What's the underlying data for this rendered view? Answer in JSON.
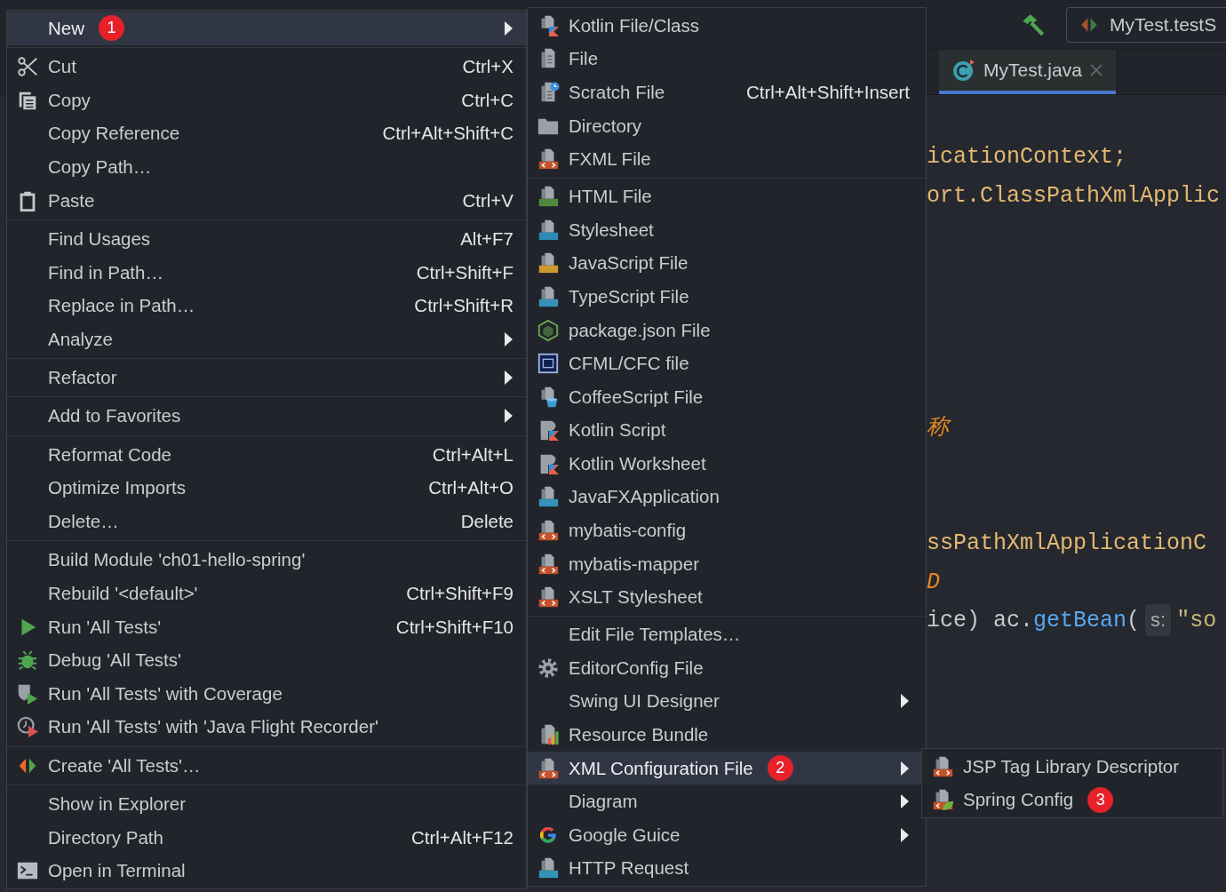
{
  "toolbar": {
    "run_configuration": {
      "label": "MyTest.testS"
    }
  },
  "editor_tabs": [
    {
      "label": "MyTest.java",
      "selected": true
    }
  ],
  "code_lines": [
    {
      "segments": [
        {
          "text": "icationContext;",
          "kind": "type"
        }
      ]
    },
    {
      "segments": [
        {
          "text": "ort.ClassPathXmlApplic",
          "kind": "type"
        }
      ]
    },
    {
      "segments": [
        {
          "text": "称",
          "kind": "accent"
        }
      ]
    },
    {
      "segments": [
        {
          "text": "ssPathXmlApplicationC",
          "kind": "type"
        }
      ]
    },
    {
      "segments": [
        {
          "text": "D",
          "kind": "accent"
        }
      ]
    },
    {
      "segments": [
        {
          "text": "ice) ac.",
          "kind": "plain"
        },
        {
          "text": "getBean",
          "kind": "method"
        },
        {
          "text": "(",
          "kind": "plain"
        },
        {
          "text": "s:",
          "kind": "hint"
        },
        {
          "text": "\"so",
          "kind": "string"
        }
      ]
    }
  ],
  "main_menu": {
    "groups": [
      {
        "items": [
          {
            "label": "New",
            "selected": true,
            "submenu": true,
            "badge": "1"
          }
        ]
      },
      {
        "items": [
          {
            "label": "Cut",
            "selected": false,
            "submenu": false,
            "shortcut": "Ctrl+X"
          },
          {
            "label": "Copy",
            "selected": false,
            "submenu": false,
            "shortcut": "Ctrl+C"
          },
          {
            "label": "Copy Reference",
            "selected": false,
            "submenu": false,
            "shortcut": "Ctrl+Alt+Shift+C"
          },
          {
            "label": "Copy Path…",
            "selected": false,
            "submenu": false
          },
          {
            "label": "Paste",
            "selected": false,
            "submenu": false,
            "shortcut": "Ctrl+V"
          }
        ]
      },
      {
        "items": [
          {
            "label": "Find Usages",
            "selected": false,
            "submenu": false,
            "shortcut": "Alt+F7"
          },
          {
            "label": "Find in Path…",
            "selected": false,
            "submenu": false,
            "shortcut": "Ctrl+Shift+F"
          },
          {
            "label": "Replace in Path…",
            "selected": false,
            "submenu": false,
            "shortcut": "Ctrl+Shift+R"
          },
          {
            "label": "Analyze",
            "selected": false,
            "submenu": true
          }
        ]
      },
      {
        "items": [
          {
            "label": "Refactor",
            "selected": false,
            "submenu": true
          }
        ]
      },
      {
        "items": [
          {
            "label": "Add to Favorites",
            "selected": false,
            "submenu": true
          }
        ]
      },
      {
        "items": [
          {
            "label": "Reformat Code",
            "selected": false,
            "submenu": false,
            "shortcut": "Ctrl+Alt+L"
          },
          {
            "label": "Optimize Imports",
            "selected": false,
            "submenu": false,
            "shortcut": "Ctrl+Alt+O"
          },
          {
            "label": "Delete…",
            "selected": false,
            "submenu": false,
            "shortcut": "Delete"
          }
        ]
      },
      {
        "items": [
          {
            "label": "Build Module 'ch01-hello-spring'",
            "selected": false,
            "submenu": false
          },
          {
            "label": "Rebuild '<default>'",
            "selected": false,
            "submenu": false,
            "shortcut": "Ctrl+Shift+F9"
          },
          {
            "label": "Run 'All Tests'",
            "selected": false,
            "submenu": false,
            "shortcut": "Ctrl+Shift+F10"
          },
          {
            "label": "Debug 'All Tests'",
            "selected": false,
            "submenu": false
          },
          {
            "label": "Run 'All Tests' with Coverage",
            "selected": false,
            "submenu": false
          },
          {
            "label": "Run 'All Tests' with 'Java Flight Recorder'",
            "selected": false,
            "submenu": false
          }
        ]
      },
      {
        "items": [
          {
            "label": "Create 'All Tests'…",
            "selected": false,
            "submenu": false
          }
        ]
      },
      {
        "items": [
          {
            "label": "Show in Explorer",
            "selected": false,
            "submenu": false
          },
          {
            "label": "Directory Path",
            "selected": false,
            "submenu": false,
            "shortcut": "Ctrl+Alt+F12"
          },
          {
            "label": "Open in Terminal",
            "selected": false,
            "submenu": false
          }
        ]
      }
    ]
  },
  "new_submenu": {
    "groups": [
      {
        "items": [
          {
            "label": "Kotlin File/Class",
            "selected": false,
            "submenu": false
          },
          {
            "label": "File",
            "selected": false,
            "submenu": false
          },
          {
            "label": "Scratch File",
            "selected": false,
            "submenu": false,
            "shortcut": "Ctrl+Alt+Shift+Insert"
          },
          {
            "label": "Directory",
            "selected": false,
            "submenu": false
          },
          {
            "label": "FXML File",
            "selected": false,
            "submenu": false
          }
        ]
      },
      {
        "items": [
          {
            "label": "HTML File",
            "selected": false,
            "submenu": false
          },
          {
            "label": "Stylesheet",
            "selected": false,
            "submenu": false
          },
          {
            "label": "JavaScript File",
            "selected": false,
            "submenu": false
          },
          {
            "label": "TypeScript File",
            "selected": false,
            "submenu": false
          },
          {
            "label": "package.json File",
            "selected": false,
            "submenu": false
          },
          {
            "label": "CFML/CFC file",
            "selected": false,
            "submenu": false
          },
          {
            "label": "CoffeeScript File",
            "selected": false,
            "submenu": false
          },
          {
            "label": "Kotlin Script",
            "selected": false,
            "submenu": false
          },
          {
            "label": "Kotlin Worksheet",
            "selected": false,
            "submenu": false
          },
          {
            "label": "JavaFXApplication",
            "selected": false,
            "submenu": false
          },
          {
            "label": "mybatis-config",
            "selected": false,
            "submenu": false
          },
          {
            "label": "mybatis-mapper",
            "selected": false,
            "submenu": false
          },
          {
            "label": "XSLT Stylesheet",
            "selected": false,
            "submenu": false
          }
        ]
      },
      {
        "items": [
          {
            "label": "Edit File Templates…",
            "selected": false,
            "submenu": false
          },
          {
            "label": "EditorConfig File",
            "selected": false,
            "submenu": false
          },
          {
            "label": "Swing UI Designer",
            "selected": false,
            "submenu": true
          },
          {
            "label": "Resource Bundle",
            "selected": false,
            "submenu": false
          },
          {
            "label": "XML Configuration File",
            "selected": true,
            "submenu": true,
            "badge": "2"
          },
          {
            "label": "Diagram",
            "selected": false,
            "submenu": true
          },
          {
            "label": "Google Guice",
            "selected": false,
            "submenu": true
          },
          {
            "label": "HTTP Request",
            "selected": false,
            "submenu": false
          }
        ]
      }
    ]
  },
  "xml_submenu": {
    "groups": [
      {
        "items": [
          {
            "label": "JSP Tag Library Descriptor",
            "selected": false,
            "submenu": false
          },
          {
            "label": "Spring Config",
            "selected": false,
            "submenu": false,
            "badge": "3"
          }
        ]
      }
    ]
  }
}
